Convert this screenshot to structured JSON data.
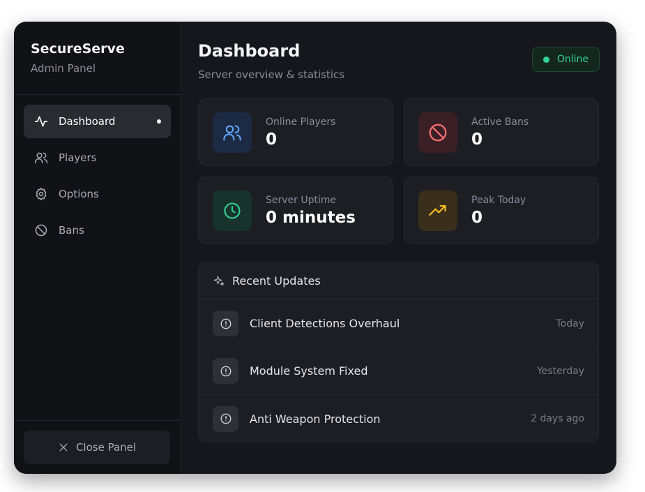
{
  "brand": {
    "title": "SecureServe",
    "subtitle": "Admin Panel"
  },
  "nav": [
    {
      "label": "Dashboard",
      "icon": "activity-icon",
      "active": true
    },
    {
      "label": "Players",
      "icon": "users-icon",
      "active": false
    },
    {
      "label": "Options",
      "icon": "gear-icon",
      "active": false
    },
    {
      "label": "Bans",
      "icon": "ban-icon",
      "active": false
    }
  ],
  "footer": {
    "close_label": "Close Panel"
  },
  "header": {
    "title": "Dashboard",
    "subtitle": "Server overview & statistics"
  },
  "status": {
    "label": "Online",
    "color": "#34d399"
  },
  "stats": [
    {
      "label": "Online Players",
      "value": "0",
      "icon": "users-icon",
      "color": "#60a5fa"
    },
    {
      "label": "Active Bans",
      "value": "0",
      "icon": "ban-icon",
      "color": "#f87171"
    },
    {
      "label": "Server Uptime",
      "value": "0 minutes",
      "icon": "clock-icon",
      "color": "#34d399"
    },
    {
      "label": "Peak Today",
      "value": "0",
      "icon": "trending-up-icon",
      "color": "#fbbf24"
    }
  ],
  "updates": {
    "title": "Recent Updates",
    "items": [
      {
        "title": "Client Detections Overhaul",
        "time": "Today"
      },
      {
        "title": "Module System Fixed",
        "time": "Yesterday"
      },
      {
        "title": "Anti Weapon Protection",
        "time": "2 days ago"
      }
    ]
  }
}
